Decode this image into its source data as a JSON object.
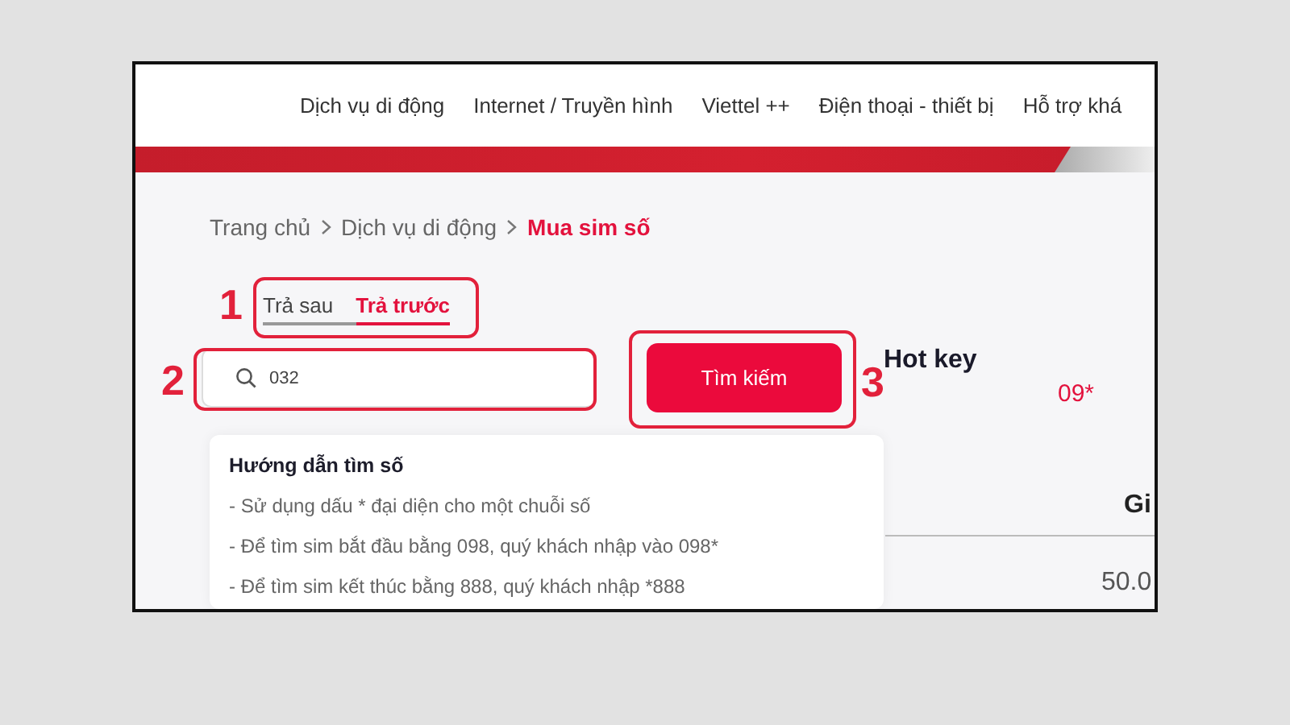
{
  "nav": {
    "items": [
      "Dịch vụ di động",
      "Internet / Truyền hình",
      "Viettel ++",
      "Điện thoại - thiết bị",
      "Hỗ trợ khá"
    ]
  },
  "breadcrumb": [
    {
      "label": "Trang chủ",
      "current": false
    },
    {
      "label": "Dịch vụ di động",
      "current": false
    },
    {
      "label": "Mua sim số",
      "current": true
    }
  ],
  "tabs": [
    {
      "label": "Trả sau",
      "selected": false
    },
    {
      "label": "Trả trước",
      "selected": true
    }
  ],
  "search": {
    "value": "032"
  },
  "search_button": "Tìm kiếm",
  "hint_panel": {
    "title": "Hướng dẫn tìm số",
    "lines": [
      "- Sử dụng dấu * đại diện cho một chuỗi số",
      "- Để tìm sim bắt đầu bằng 098, quý khách nhập vào 098*",
      "- Để tìm sim kết thúc bằng 888, quý khách nhập *888"
    ]
  },
  "hot_key": {
    "title": "Hot key",
    "items": [
      "09*"
    ]
  },
  "table": {
    "columns": [
      "Gi"
    ],
    "rows": [
      [
        "50.0"
      ]
    ]
  },
  "annotations": [
    "1",
    "2",
    "3"
  ]
}
